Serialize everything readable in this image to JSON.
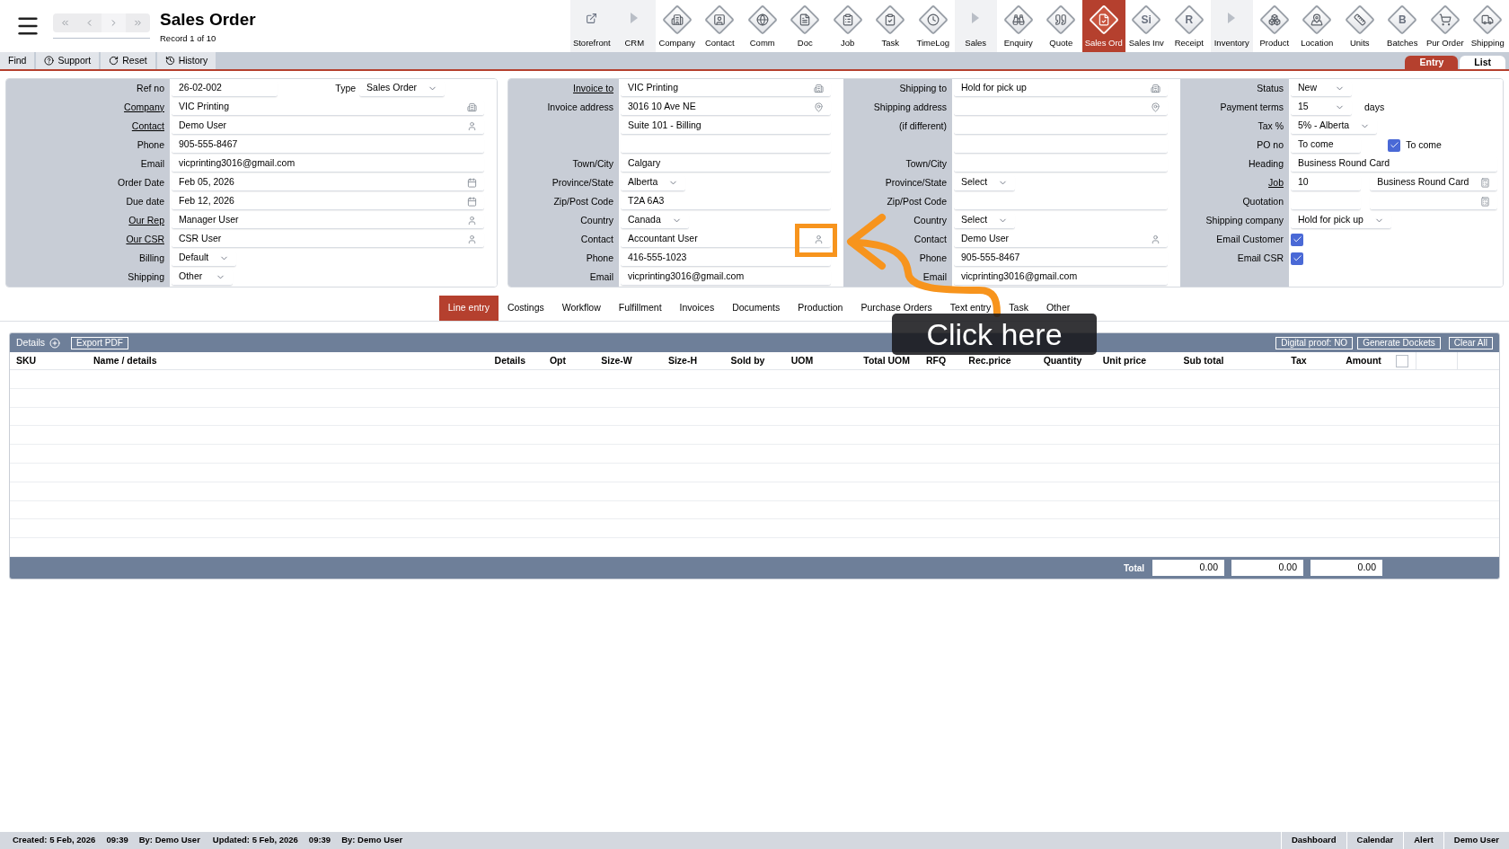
{
  "header": {
    "title": "Sales Order",
    "subtitle": "Record 1 of 10"
  },
  "modules": [
    {
      "label": "Storefront",
      "kind": "link",
      "selected": false
    },
    {
      "label": "CRM",
      "kind": "section",
      "selected": false
    },
    {
      "label": "Company",
      "kind": "module",
      "selected": false
    },
    {
      "label": "Contact",
      "kind": "module",
      "selected": false
    },
    {
      "label": "Comm",
      "kind": "module",
      "selected": false
    },
    {
      "label": "Doc",
      "kind": "module",
      "selected": false
    },
    {
      "label": "Job",
      "kind": "module",
      "selected": false
    },
    {
      "label": "Task",
      "kind": "module",
      "selected": false
    },
    {
      "label": "TimeLog",
      "kind": "module",
      "selected": false
    },
    {
      "label": "Sales",
      "kind": "section",
      "selected": false
    },
    {
      "label": "Enquiry",
      "kind": "module",
      "selected": false
    },
    {
      "label": "Quote",
      "kind": "module",
      "selected": false
    },
    {
      "label": "Sales Ord",
      "kind": "module",
      "selected": true
    },
    {
      "label": "Sales Inv",
      "kind": "module",
      "glyph": "Si",
      "selected": false
    },
    {
      "label": "Receipt",
      "kind": "module",
      "glyph": "R",
      "selected": false
    },
    {
      "label": "Inventory",
      "kind": "section",
      "selected": false
    },
    {
      "label": "Product",
      "kind": "module",
      "selected": false
    },
    {
      "label": "Location",
      "kind": "module",
      "selected": false
    },
    {
      "label": "Units",
      "kind": "module",
      "selected": false
    },
    {
      "label": "Batches",
      "kind": "module",
      "glyph": "B",
      "selected": false
    },
    {
      "label": "Pur Order",
      "kind": "module",
      "selected": false
    },
    {
      "label": "Shipping",
      "kind": "module",
      "selected": false
    }
  ],
  "toolbar": [
    {
      "label": "Find",
      "kind": "plain"
    },
    {
      "label": "Support",
      "kind": "help"
    },
    {
      "label": "Reset",
      "kind": "reset"
    },
    {
      "label": "History",
      "kind": "history"
    }
  ],
  "view_tabs": [
    {
      "label": "Entry",
      "selected": true
    },
    {
      "label": "List",
      "selected": false
    }
  ],
  "customer_panel": [
    {
      "label": "Ref no",
      "link": false,
      "fields": [
        {
          "kind": "text",
          "value": "26-02-002"
        },
        {
          "kind": "label",
          "value": "Type"
        },
        {
          "kind": "select",
          "value": "Sales Order"
        }
      ]
    },
    {
      "label": "Company",
      "link": true,
      "fields": [
        {
          "kind": "company",
          "value": "VIC Printing"
        }
      ]
    },
    {
      "label": "Contact",
      "link": true,
      "fields": [
        {
          "kind": "person",
          "value": "Demo User"
        }
      ]
    },
    {
      "label": "Phone",
      "link": false,
      "fields": [
        {
          "kind": "text",
          "value": "905-555-8467"
        }
      ]
    },
    {
      "label": "Email",
      "link": false,
      "fields": [
        {
          "kind": "text",
          "value": "vicprinting3016@gmail.com"
        }
      ]
    },
    {
      "label": "Order Date",
      "link": false,
      "fields": [
        {
          "kind": "date",
          "value": "Feb 05, 2026"
        }
      ]
    },
    {
      "label": "Due date",
      "link": false,
      "fields": [
        {
          "kind": "date",
          "value": "Feb 12, 2026"
        }
      ]
    },
    {
      "label": "Our Rep",
      "link": true,
      "fields": [
        {
          "kind": "person",
          "value": "Manager User"
        }
      ]
    },
    {
      "label": "Our CSR",
      "link": true,
      "fields": [
        {
          "kind": "person",
          "value": "CSR User"
        }
      ]
    },
    {
      "label": "Billing",
      "link": false,
      "fields": [
        {
          "kind": "select",
          "value": "Default"
        }
      ]
    },
    {
      "label": "Shipping",
      "link": false,
      "fields": [
        {
          "kind": "select",
          "value": "Other"
        }
      ]
    }
  ],
  "invoice_panel": [
    {
      "label": "Invoice to",
      "link": true,
      "fields": [
        {
          "kind": "company",
          "value": "VIC Printing"
        }
      ]
    },
    {
      "label": "Invoice address",
      "link": false,
      "fields": [
        {
          "kind": "pin",
          "value": "3016 10 Ave NE"
        }
      ]
    },
    {
      "fields": [
        {
          "kind": "text",
          "value": "Suite 101 - Billing"
        }
      ]
    },
    {
      "fields": [
        {
          "kind": "text"
        }
      ]
    },
    {
      "label": "Town/City",
      "link": false,
      "fields": [
        {
          "kind": "text",
          "value": "Calgary"
        }
      ]
    },
    {
      "label": "Province/State",
      "link": false,
      "fields": [
        {
          "kind": "select",
          "value": "Alberta"
        }
      ]
    },
    {
      "label": "Zip/Post Code",
      "link": false,
      "fields": [
        {
          "kind": "text",
          "value": "T2A 6A3"
        }
      ]
    },
    {
      "label": "Country",
      "link": false,
      "fields": [
        {
          "kind": "select",
          "value": "Canada"
        }
      ]
    },
    {
      "label": "Contact",
      "link": false,
      "fields": [
        {
          "kind": "person",
          "value": "Accountant User"
        }
      ]
    },
    {
      "label": "Phone",
      "link": false,
      "fields": [
        {
          "kind": "text",
          "value": "416-555-1023"
        }
      ]
    },
    {
      "label": "Email",
      "link": false,
      "fields": [
        {
          "kind": "text",
          "value": "vicprinting3016@gmail.com"
        }
      ]
    }
  ],
  "shipping_panel": [
    {
      "label": "Shipping to",
      "link": false,
      "fields": [
        {
          "kind": "company",
          "value": "Hold for pick up"
        }
      ]
    },
    {
      "label": "Shipping address",
      "link": false,
      "fields": [
        {
          "kind": "pin"
        }
      ]
    },
    {
      "label": "(if different)",
      "link": false,
      "fields": [
        {
          "kind": "text"
        }
      ]
    },
    {
      "fields": [
        {
          "kind": "text"
        }
      ]
    },
    {
      "label": "Town/City",
      "link": false,
      "fields": [
        {
          "kind": "text"
        }
      ]
    },
    {
      "label": "Province/State",
      "link": false,
      "fields": [
        {
          "kind": "select",
          "value": "Select"
        }
      ]
    },
    {
      "label": "Zip/Post Code",
      "link": false,
      "fields": [
        {
          "kind": "text"
        }
      ]
    },
    {
      "label": "Country",
      "link": false,
      "fields": [
        {
          "kind": "select",
          "value": "Select"
        }
      ]
    },
    {
      "label": "Contact",
      "link": false,
      "fields": [
        {
          "kind": "person",
          "value": "Demo User"
        }
      ]
    },
    {
      "label": "Phone",
      "link": false,
      "fields": [
        {
          "kind": "text",
          "value": "905-555-8467"
        }
      ]
    },
    {
      "label": "Email",
      "link": false,
      "fields": [
        {
          "kind": "text",
          "value": "vicprinting3016@gmail.com"
        }
      ]
    }
  ],
  "status_panel": [
    {
      "label": "Status",
      "link": false,
      "fields": [
        {
          "kind": "select",
          "value": "New"
        }
      ]
    },
    {
      "label": "Payment terms",
      "link": false,
      "fields": [
        {
          "kind": "select",
          "value": "15"
        },
        {
          "kind": "note",
          "value": "days"
        }
      ]
    },
    {
      "label": "Tax %",
      "link": false,
      "fields": [
        {
          "kind": "select",
          "value": "5% - Alberta"
        }
      ]
    },
    {
      "label": "PO no",
      "link": false,
      "fields": [
        {
          "kind": "text",
          "value": "To come"
        },
        {
          "kind": "checkbox",
          "checked": true,
          "value": "To come"
        }
      ]
    },
    {
      "label": "Heading",
      "link": false,
      "fields": [
        {
          "kind": "text",
          "value": "Business Round Card"
        }
      ]
    },
    {
      "label": "Job",
      "link": true,
      "fields": [
        {
          "kind": "text",
          "value": "10"
        },
        {
          "kind": "calc",
          "value": "Business Round Card"
        }
      ]
    },
    {
      "label": "Quotation",
      "link": false,
      "fields": [
        {
          "kind": "text"
        },
        {
          "kind": "calc"
        }
      ]
    },
    {
      "label": "Shipping company",
      "link": false,
      "fields": [
        {
          "kind": "select",
          "value": "Hold for pick up"
        }
      ]
    },
    {
      "label": "Email Customer",
      "link": false,
      "fields": [
        {
          "kind": "checkbox",
          "checked": true
        }
      ]
    },
    {
      "label": "Email CSR",
      "link": false,
      "fields": [
        {
          "kind": "checkbox",
          "checked": true
        }
      ]
    }
  ],
  "detail_tabs": [
    {
      "label": "Line entry",
      "selected": true
    },
    {
      "label": "Costings",
      "selected": false
    },
    {
      "label": "Workflow",
      "selected": false
    },
    {
      "label": "Fulfillment",
      "selected": false
    },
    {
      "label": "Invoices",
      "selected": false
    },
    {
      "label": "Documents",
      "selected": false
    },
    {
      "label": "Production",
      "selected": false
    },
    {
      "label": "Purchase Orders",
      "selected": false
    },
    {
      "label": "Text entry",
      "selected": false
    },
    {
      "label": "Task",
      "selected": false
    },
    {
      "label": "Other",
      "selected": false
    }
  ],
  "table": {
    "title": "Details",
    "left_buttons": [
      "Export PDF"
    ],
    "right_buttons": [
      "Digital proof: NO",
      "Generate Dockets",
      "Clear All"
    ],
    "columns": [
      "SKU",
      "Name / details",
      "Details",
      "Opt",
      "Size-W",
      "Size-H",
      "Sold by",
      "UOM",
      "Total UOM",
      "RFQ",
      "Rec.price",
      "Quantity",
      "Unit price",
      "Sub total",
      "Tax",
      "Amount"
    ],
    "select_all": {
      "checked": false
    },
    "total_label": "Total",
    "totals": [
      "0.00",
      "0.00",
      "0.00"
    ]
  },
  "tutorial": {
    "callout": "Click here"
  },
  "status_bar": {
    "left": [
      "Created: 5 Feb, 2026",
      "09:39",
      "By: Demo User",
      "Updated: 5 Feb, 2026",
      "09:39",
      "By: Demo User"
    ],
    "right": [
      "Dashboard",
      "Calendar",
      "Alert",
      "Demo User"
    ]
  }
}
